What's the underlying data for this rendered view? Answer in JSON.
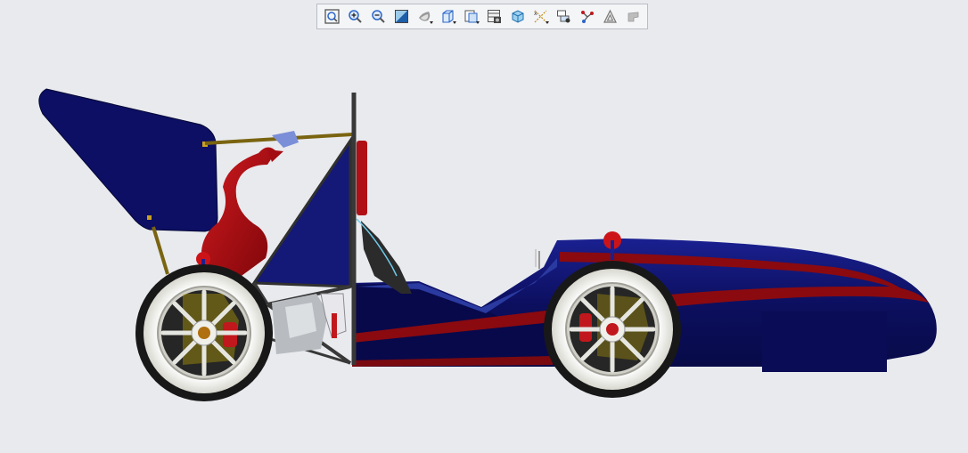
{
  "viewer": {
    "background_color": "#e8eaee",
    "toolbar": {
      "buttons": [
        {
          "name": "refit-button",
          "icon": "refit-icon",
          "has_menu": false
        },
        {
          "name": "zoom-in-button",
          "icon": "zoom-in-icon",
          "has_menu": false
        },
        {
          "name": "zoom-out-button",
          "icon": "zoom-out-icon",
          "has_menu": false
        },
        {
          "name": "repaint-button",
          "icon": "repaint-icon",
          "has_menu": false
        },
        {
          "name": "display-style-button",
          "icon": "display-style-icon",
          "has_menu": true
        },
        {
          "name": "saved-orientations-button",
          "icon": "saved-orientations-icon",
          "has_menu": true
        },
        {
          "name": "view-manager-button",
          "icon": "view-manager-icon",
          "has_menu": true
        },
        {
          "name": "section-view-button",
          "icon": "section-view-icon",
          "has_menu": false
        },
        {
          "name": "perspective-view-button",
          "icon": "perspective-view-icon",
          "has_menu": false
        },
        {
          "name": "datum-display-button",
          "icon": "datum-display-icon",
          "has_menu": true
        },
        {
          "name": "annotation-display-button",
          "icon": "annotation-display-icon",
          "has_menu": false
        },
        {
          "name": "spin-center-button",
          "icon": "spin-center-icon",
          "has_menu": false
        },
        {
          "name": "simulation-display-button",
          "icon": "simulation-display-icon",
          "has_menu": false
        },
        {
          "name": "appearance-button",
          "icon": "appearance-icon",
          "has_menu": false
        }
      ]
    },
    "model": {
      "body_color": "#0c0f5e",
      "stripe_color": "#8a0a10",
      "accent_red": "#c0181c",
      "tire_color": "#1a1a1a",
      "rim_color": "#f2f2ea"
    }
  }
}
